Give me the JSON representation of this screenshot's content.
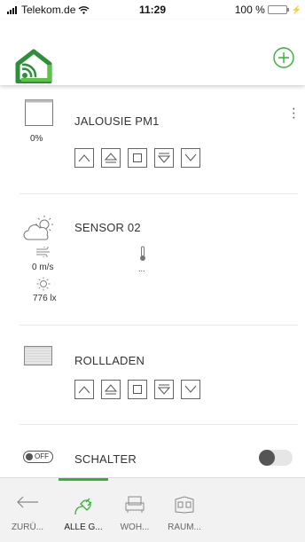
{
  "status": {
    "carrier": "Telekom.de",
    "time": "11:29",
    "battery": "100 %"
  },
  "colors": {
    "accent": "#33b233",
    "brand": "#2e8f3a"
  },
  "header": {
    "logo_icon": "home-wifi-logo",
    "add_icon": "plus-circle-icon"
  },
  "devices": {
    "jalousie": {
      "title": "JALOUSIE PM1",
      "position": "0%"
    },
    "sensor": {
      "title": "SENSOR 02",
      "wind": "0 m/s",
      "temp": "...",
      "lux": "776 lx"
    },
    "rollladen": {
      "title": "ROLLLADEN"
    },
    "schalter": {
      "title": "SCHALTER",
      "badge": "OFF",
      "state": "off"
    }
  },
  "tabs": [
    {
      "label": "ZURÜ...",
      "icon": "arrow-left-icon"
    },
    {
      "label": "ALLE G...",
      "icon": "plug-icon",
      "active": true
    },
    {
      "label": "WOH...",
      "icon": "sofa-icon"
    },
    {
      "label": "RAUM...",
      "icon": "room-icon"
    }
  ]
}
